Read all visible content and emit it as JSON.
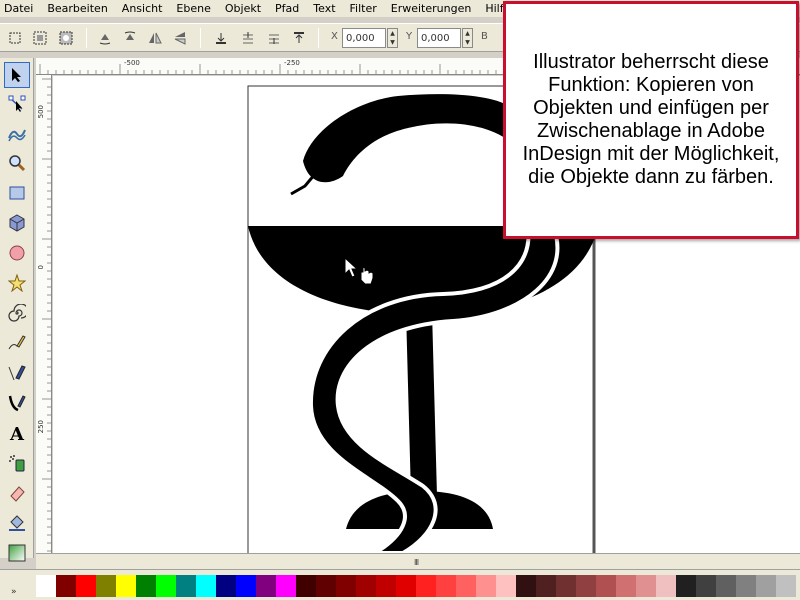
{
  "menu": {
    "items": [
      "Datei",
      "Bearbeiten",
      "Ansicht",
      "Ebene",
      "Objekt",
      "Pfad",
      "Text",
      "Filter",
      "Erweiterungen",
      "Hilfe"
    ]
  },
  "toolbar": {
    "x_label": "X",
    "x_value": "0,000",
    "y_label": "Y",
    "y_value": "0,000",
    "b_label": "B"
  },
  "ruler": {
    "h_labels": [
      "-500",
      "-250"
    ],
    "v_labels": [
      "500",
      "0",
      "250"
    ]
  },
  "callout": {
    "text": "Illustrator beherrscht diese Funktion: Kopieren von Objekten und einfügen per Zwischenablage in Adobe InDesign mit der Möglichkeit, die Objekte dann zu färben."
  },
  "scrollbar": {
    "grip": "III"
  },
  "palette": {
    "toggle": "»",
    "colors": [
      "#ffffff",
      "#800000",
      "#ff0000",
      "#808000",
      "#ffff00",
      "#008000",
      "#00ff00",
      "#008080",
      "#00ffff",
      "#000080",
      "#0000ff",
      "#800080",
      "#ff00ff",
      "#400000",
      "#600000",
      "#800000",
      "#a00000",
      "#c00000",
      "#e00000",
      "#ff2020",
      "#ff4040",
      "#ff6060",
      "#ff9090",
      "#ffc0c0",
      "#301010",
      "#502020",
      "#703030",
      "#904040",
      "#b05050",
      "#d07070",
      "#e09090",
      "#f0c0c0",
      "#202020",
      "#404040",
      "#606060",
      "#808080",
      "#a0a0a0",
      "#c0c0c0"
    ]
  }
}
